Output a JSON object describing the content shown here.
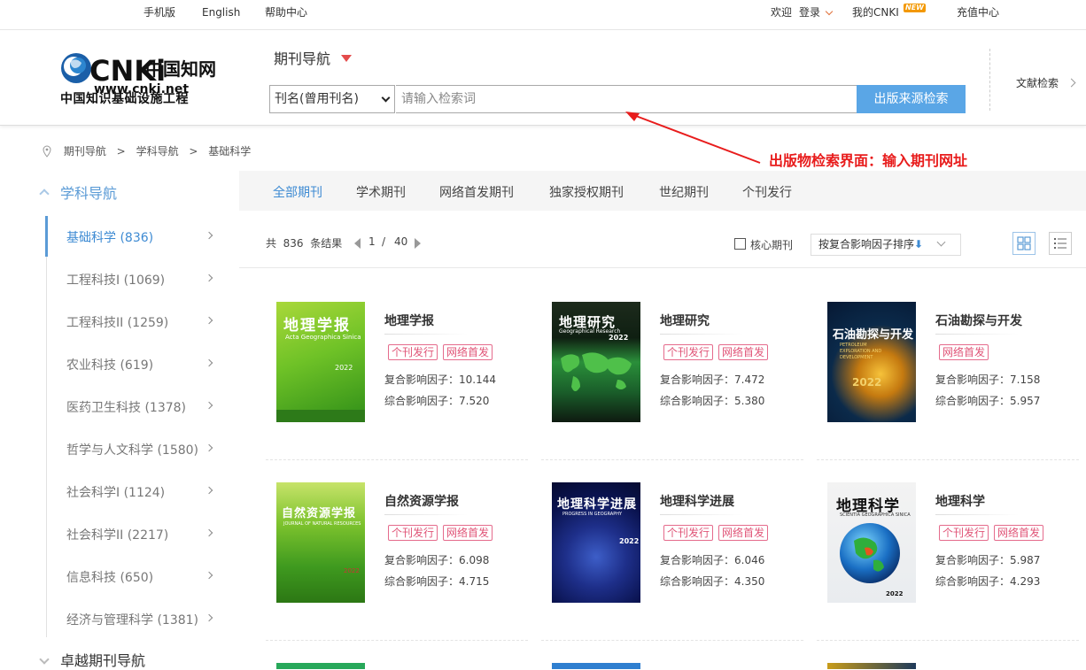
{
  "topbar": {
    "mobile": "手机版",
    "english": "English",
    "help": "帮助中心",
    "welcome": "欢迎",
    "login": "登录",
    "my_cnki": "我的CNKI",
    "new_badge": "NEW",
    "recharge": "充值中心"
  },
  "header": {
    "logo_text": "CNKi",
    "logo_cn": "中国知网",
    "logo_url": "www.cnki.net",
    "logo_sub": "中国知识基础设施工程",
    "nav_title": "期刊导航",
    "select_value": "刊名(曾用刊名)",
    "search_placeholder": "请输入检索词",
    "search_button": "出版来源检索",
    "wenxian": "文献检索"
  },
  "annotation": "出版物检索界面：输入期刊网址",
  "breadcrumb": [
    "期刊导航",
    ">",
    "学科导航",
    ">",
    "基础科学"
  ],
  "sidebar": {
    "heading": "学科导航",
    "items": [
      {
        "label": "基础科学 (836)"
      },
      {
        "label": "工程科技I (1069)"
      },
      {
        "label": "工程科技II (1259)"
      },
      {
        "label": "农业科技 (619)"
      },
      {
        "label": "医药卫生科技 (1378)"
      },
      {
        "label": "哲学与人文科学 (1580)"
      },
      {
        "label": "社会科学I (1124)"
      },
      {
        "label": "社会科学II (2217)"
      },
      {
        "label": "信息科技 (650)"
      },
      {
        "label": "经济与管理科学 (1381)"
      }
    ],
    "heading2": "卓越期刊导航"
  },
  "tabs": [
    "全部期刊",
    "学术期刊",
    "网络首发期刊",
    "独家授权期刊",
    "世纪期刊",
    "个刊发行"
  ],
  "results": {
    "prefix": "共",
    "count": "836",
    "suffix": "条结果",
    "page_current": "1",
    "page_sep": "/",
    "page_total": "40",
    "core_label": "核心期刊",
    "sort_label": "按复合影响因子排序",
    "sort_arrow": "⬇"
  },
  "journals": [
    {
      "title": "地理学报",
      "tags": [
        "个刊发行",
        "网络首发"
      ],
      "if1": "复合影响因子：10.144",
      "if2": "综合影响因子：7.520",
      "cover_title": "地理学报",
      "cover_sub": "Acta Geographica Sinica",
      "cover_year": "2022"
    },
    {
      "title": "地理研究",
      "tags": [
        "个刊发行",
        "网络首发"
      ],
      "if1": "复合影响因子：7.472",
      "if2": "综合影响因子：5.380",
      "cover_title": "地理研究",
      "cover_sub": "Geographical Research",
      "cover_year": "2022"
    },
    {
      "title": "石油勘探与开发",
      "tags": [
        "网络首发"
      ],
      "if1": "复合影响因子：7.158",
      "if2": "综合影响因子：5.957",
      "cover_title": "石油勘探与开发",
      "cover_sub": "PETROLEUM EXPLORATION AND DEVELOPMENT",
      "cover_year": "2022"
    },
    {
      "title": "自然资源学报",
      "tags": [
        "个刊发行",
        "网络首发"
      ],
      "if1": "复合影响因子：6.098",
      "if2": "综合影响因子：4.715",
      "cover_title": "自然资源学报",
      "cover_sub": "JOURNAL OF NATURAL RESOURCES",
      "cover_year": "2022"
    },
    {
      "title": "地理科学进展",
      "tags": [
        "个刊发行",
        "网络首发"
      ],
      "if1": "复合影响因子：6.046",
      "if2": "综合影响因子：4.350",
      "cover_title": "地理科学进展",
      "cover_sub": "PROGRESS IN GEOGRAPHY",
      "cover_year": "2022"
    },
    {
      "title": "地理科学",
      "tags": [
        "个刊发行",
        "网络首发"
      ],
      "if1": "复合影响因子：5.987",
      "if2": "综合影响因子：4.293",
      "cover_title": "地理科学",
      "cover_sub": "SCIENTIA GEOGRAPHICA SINICA",
      "cover_year": "2022"
    }
  ],
  "colors": {
    "accent": "#3e8bd3",
    "button": "#5aa6e6",
    "tag": "#e05477",
    "annotation": "#e81c1c"
  }
}
